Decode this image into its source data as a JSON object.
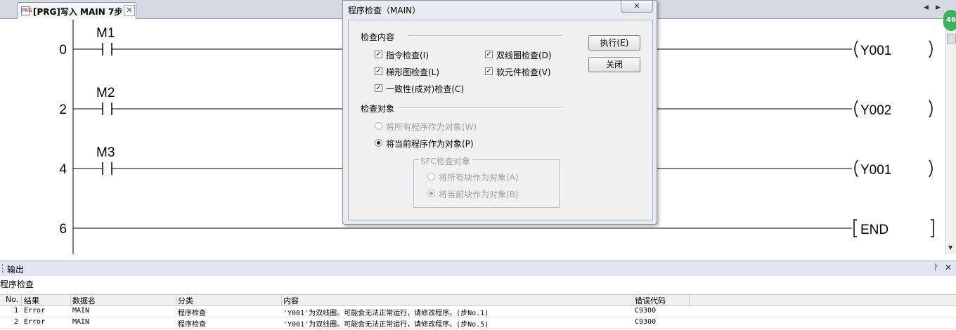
{
  "tab": {
    "title": "[PRG]写入 MAIN 7步",
    "icon_name": "program-icon",
    "close_glyph": "✕"
  },
  "tab_nav": {
    "left": "◀",
    "right": "▶",
    "close": "✕"
  },
  "badge": {
    "text": "46"
  },
  "ladder": {
    "rungs": [
      {
        "step": "0",
        "contact": "M1",
        "coil": "Y001",
        "coil_type": "coil"
      },
      {
        "step": "2",
        "contact": "M2",
        "coil": "Y002",
        "coil_type": "coil"
      },
      {
        "step": "4",
        "contact": "M3",
        "coil": "Y001",
        "coil_type": "coil"
      },
      {
        "step": "6",
        "contact": "",
        "coil": "END",
        "coil_type": "end"
      }
    ]
  },
  "dialog": {
    "title": "程序检查（MAIN）",
    "close_glyph": "✕",
    "check_content_label": "检查内容",
    "options": [
      {
        "label": "指令检查(I)",
        "checked": true
      },
      {
        "label": "双线圈检查(D)",
        "checked": true
      },
      {
        "label": "梯形图检查(L)",
        "checked": true
      },
      {
        "label": "软元件检查(V)",
        "checked": true
      },
      {
        "label": "一致性(成对)检查(C)",
        "checked": true
      }
    ],
    "check_target_label": "检查对象",
    "targets": [
      {
        "label": "将所有程序作为对象(W)",
        "selected": false,
        "disabled": true
      },
      {
        "label": "将当前程序作为对象(P)",
        "selected": true,
        "disabled": false
      }
    ],
    "sfc_label": "SFC检查对象",
    "sfc_targets": [
      {
        "label": "将所有块作为对象(A)",
        "selected": false,
        "disabled": true
      },
      {
        "label": "将当前块作为对象(B)",
        "selected": true,
        "disabled": true
      }
    ],
    "execute_label": "执行(E)",
    "close_label": "关闭"
  },
  "output": {
    "title": "输出",
    "pin_glyph": "ᚹ",
    "close_glyph": "✕",
    "subtitle": "程序检查",
    "columns": [
      "No.",
      "结果",
      "数据名",
      "分类",
      "内容",
      "错误代码"
    ],
    "rows": [
      [
        "1",
        "Error",
        "MAIN",
        "程序检查",
        "'Y001'为双线圈。可能会无法正常运行，请修改程序。(步No.1)",
        "C9300"
      ],
      [
        "2",
        "Error",
        "MAIN",
        "程序检查",
        "'Y001'为双线圈。可能会无法正常运行，请修改程序。(步No.5)",
        "C9300"
      ]
    ]
  },
  "colors": {
    "ladder_line": "#000000",
    "dialog_bg": "#f0f0f0",
    "output_header": "#dfe6f0",
    "badge": "#3cb35a"
  }
}
